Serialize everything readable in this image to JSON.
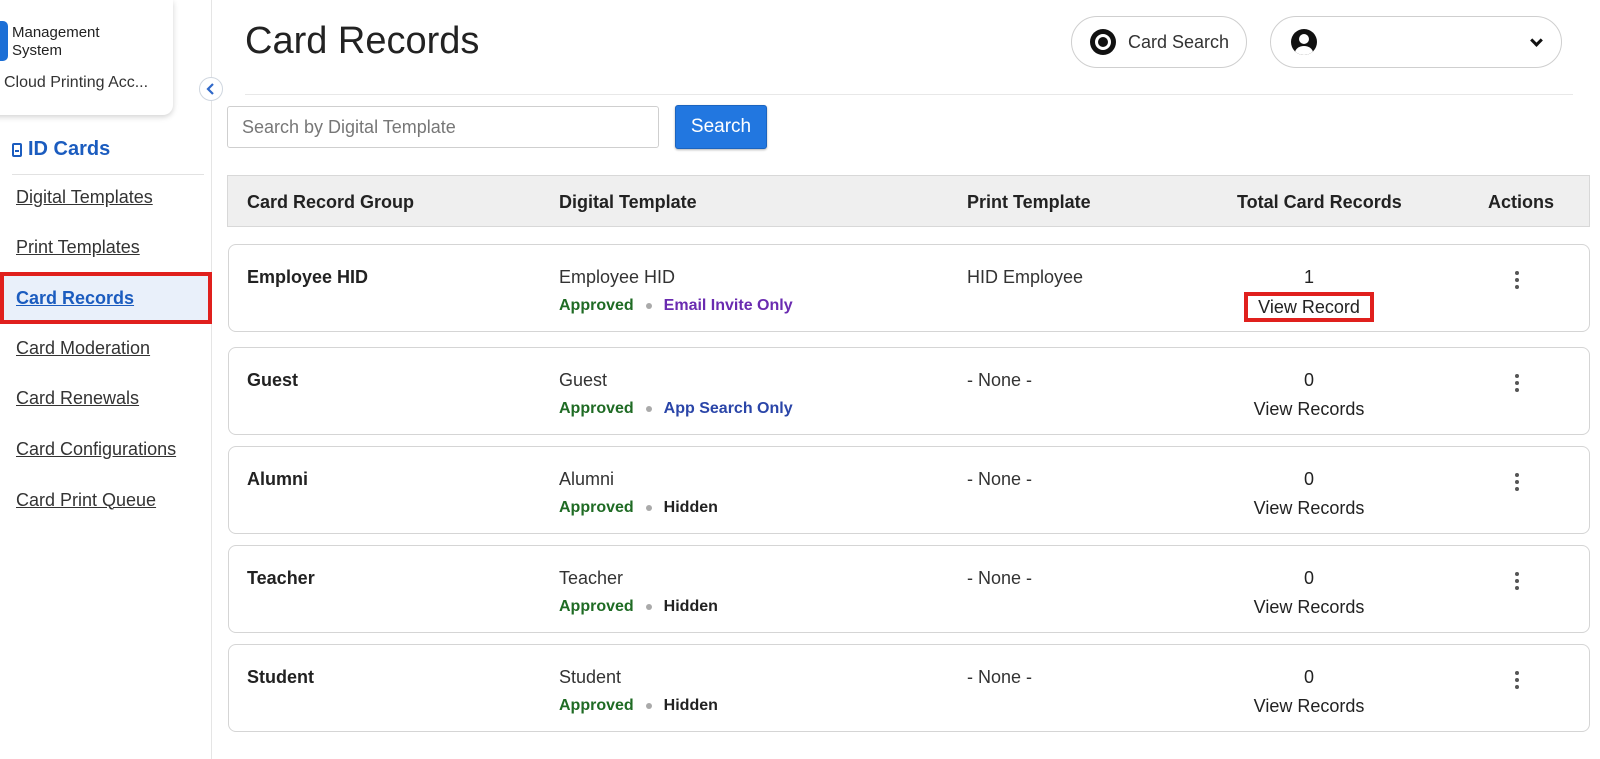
{
  "sidebar": {
    "brand_name": "Management System",
    "brand_sub": "Cloud Printing Acc...",
    "section_title": "ID Cards",
    "items": [
      {
        "label": "Digital Templates"
      },
      {
        "label": "Print Templates"
      },
      {
        "label": "Card Records"
      },
      {
        "label": "Card Moderation"
      },
      {
        "label": "Card Renewals"
      },
      {
        "label": "Card Configurations"
      },
      {
        "label": "Card Print Queue"
      }
    ]
  },
  "header": {
    "title": "Card Records",
    "card_search_label": "Card Search",
    "user_name": ""
  },
  "search": {
    "placeholder": "Search by Digital Template",
    "value": "",
    "button_label": "Search"
  },
  "table": {
    "columns": [
      "Card Record Group",
      "Digital Template",
      "Print Template",
      "Total Card Records",
      "Actions"
    ],
    "rows": [
      {
        "group": "Employee HID",
        "digital_template": "Employee HID",
        "status": "Approved",
        "visibility": "Email Invite Only",
        "visibility_color": "#6a2bb0",
        "print_template": "HID Employee",
        "total": "1",
        "link": "View Record"
      },
      {
        "group": "Guest",
        "digital_template": "Guest",
        "status": "Approved",
        "visibility": "App Search Only",
        "visibility_color": "#2a45a8",
        "print_template": "- None -",
        "total": "0",
        "link": "View Records"
      },
      {
        "group": "Alumni",
        "digital_template": "Alumni",
        "status": "Approved",
        "visibility": "Hidden",
        "visibility_color": "#222222",
        "print_template": "- None -",
        "total": "0",
        "link": "View Records"
      },
      {
        "group": "Teacher",
        "digital_template": "Teacher",
        "status": "Approved",
        "visibility": "Hidden",
        "visibility_color": "#222222",
        "print_template": "- None -",
        "total": "0",
        "link": "View Records"
      },
      {
        "group": "Student",
        "digital_template": "Student",
        "status": "Approved",
        "visibility": "Hidden",
        "visibility_color": "#222222",
        "print_template": "- None -",
        "total": "0",
        "link": "View Records"
      }
    ]
  },
  "colors": {
    "accent": "#2277e0",
    "active_nav": "#1b5cbf",
    "approved": "#1f6b24",
    "highlight": "#e0201d"
  }
}
